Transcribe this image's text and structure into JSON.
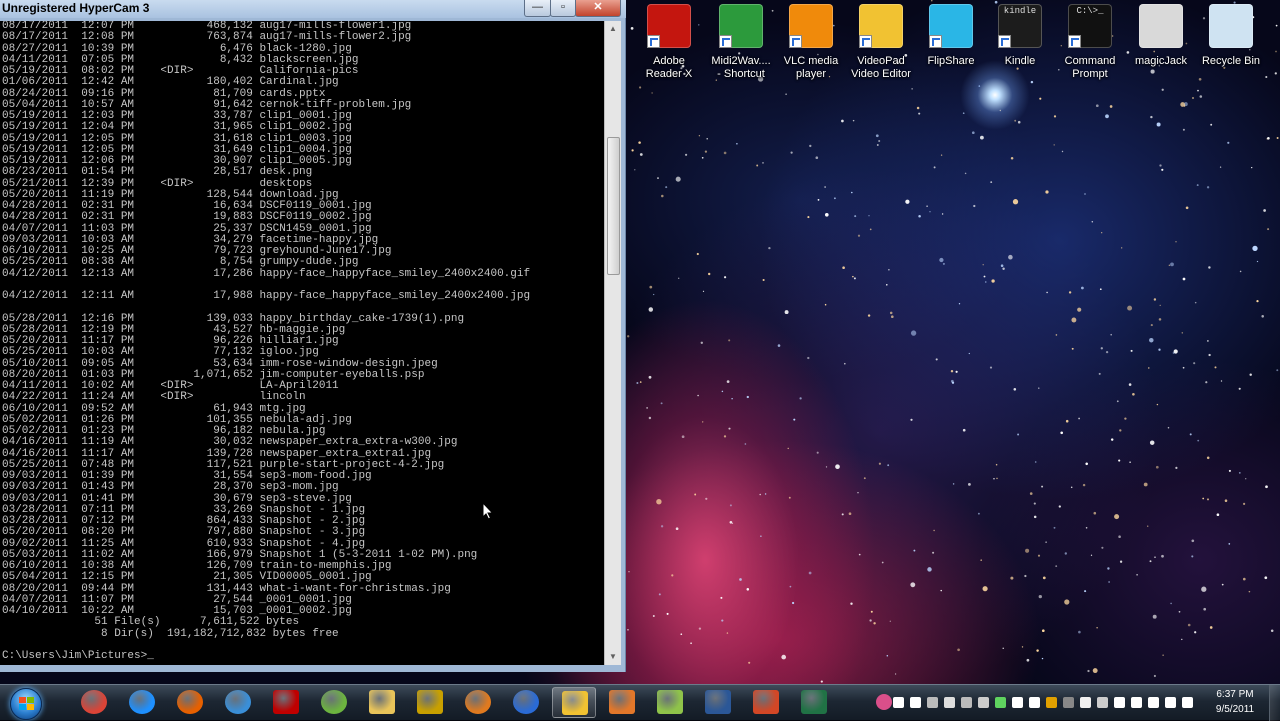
{
  "window": {
    "title": "Unregistered HyperCam 3",
    "buttons": {
      "minimize": "—",
      "maximize": "▫",
      "close": "✕"
    }
  },
  "console": {
    "lines": [
      "08/17/2011  12:07 PM           468,132 aug17-mills-flower1.jpg",
      "08/17/2011  12:08 PM           763,874 aug17-mills-flower2.jpg",
      "08/27/2011  10:39 PM             6,476 black-1280.jpg",
      "04/11/2011  07:05 PM             8,432 blackscreen.jpg",
      "05/19/2011  08:02 PM    <DIR>          California-pics",
      "01/06/2011  12:42 AM           180,402 Cardinal.jpg",
      "08/24/2011  09:16 PM            81,709 cards.pptx",
      "05/04/2011  10:57 AM            91,642 cernok-tiff-problem.jpg",
      "05/19/2011  12:03 PM            33,787 clip1_0001.jpg",
      "05/19/2011  12:04 PM            31,965 clip1_0002.jpg",
      "05/19/2011  12:05 PM            31,618 clip1_0003.jpg",
      "05/19/2011  12:05 PM            31,649 clip1_0004.jpg",
      "05/19/2011  12:06 PM            30,907 clip1_0005.jpg",
      "08/23/2011  01:54 PM            28,517 desk.png",
      "05/21/2011  12:39 PM    <DIR>          desktops",
      "05/20/2011  11:19 PM           128,544 download.jpg",
      "04/28/2011  02:31 PM            16,634 DSCF0119_0001.jpg",
      "04/28/2011  02:31 PM            19,883 DSCF0119_0002.jpg",
      "04/07/2011  11:03 PM            25,337 DSCN1459_0001.jpg",
      "09/03/2011  10:03 AM            34,279 facetime-happy.jpg",
      "06/10/2011  10:25 AM            79,723 greyhound-June17.jpg",
      "05/25/2011  08:38 AM             8,754 grumpy-dude.jpg",
      "04/12/2011  12:13 AM            17,286 happy-face_happyface_smiley_2400x2400.gif",
      "",
      "04/12/2011  12:11 AM            17,988 happy-face_happyface_smiley_2400x2400.jpg",
      "",
      "05/28/2011  12:16 PM           139,033 happy_birthday_cake-1739(1).png",
      "05/28/2011  12:19 PM            43,527 hb-maggie.jpg",
      "05/20/2011  11:17 PM            96,226 hilliar1.jpg",
      "05/25/2011  10:03 AM            77,132 igloo.jpg",
      "05/10/2011  09:05 AM            53,634 imm-rose-window-design.jpeg",
      "08/20/2011  01:03 PM         1,071,652 jim-computer-eyeballs.psp",
      "04/11/2011  10:02 AM    <DIR>          LA-April2011",
      "04/22/2011  11:24 AM    <DIR>          lincoln",
      "06/10/2011  09:52 AM            61,943 mtg.jpg",
      "05/02/2011  01:26 PM           101,355 nebula-adj.jpg",
      "05/02/2011  01:23 PM            96,182 nebula.jpg",
      "04/16/2011  11:19 AM            30,032 newspaper_extra_extra-w300.jpg",
      "04/16/2011  11:17 AM           139,728 newspaper_extra_extra1.jpg",
      "05/25/2011  07:48 PM           117,521 purple-start-project-4-2.jpg",
      "09/03/2011  01:39 PM            31,554 sep3-mom-food.jpg",
      "09/03/2011  01:43 PM            28,370 sep3-mom.jpg",
      "09/03/2011  01:41 PM            30,679 sep3-steve.jpg",
      "03/28/2011  07:11 PM            33,269 Snapshot - 1.jpg",
      "03/28/2011  07:12 PM           864,433 Snapshot - 2.jpg",
      "05/20/2011  08:20 PM           797,880 Snapshot - 3.jpg",
      "09/02/2011  11:25 AM           610,933 Snapshot - 4.jpg",
      "05/03/2011  11:02 AM           166,979 Snapshot 1 (5-3-2011 1-02 PM).png",
      "06/10/2011  10:38 AM           126,709 train-to-memphis.jpg",
      "05/04/2011  12:15 PM            21,305 VID00005_0001.jpg",
      "08/20/2011  09:44 PM           131,443 what-i-want-for-christmas.jpg",
      "04/07/2011  11:07 PM            27,544 _0001_0001.jpg",
      "04/10/2011  10:22 AM            15,703 _0001_0002.jpg",
      "              51 File(s)      7,611,522 bytes",
      "               8 Dir(s)  191,182,712,832 bytes free",
      "",
      "C:\\Users\\Jim\\Pictures>_"
    ]
  },
  "desktop_icons": [
    {
      "label_line1": "Adobe",
      "label_line2": "Reader X",
      "icon": "adobe-reader-icon",
      "color": "#c4160f"
    },
    {
      "label_line1": "Midi2Wav....",
      "label_line2": "- Shortcut",
      "icon": "midi2wav-icon",
      "color": "#2c9a3c"
    },
    {
      "label_line1": "VLC media",
      "label_line2": "player",
      "icon": "vlc-icon",
      "color": "#f08a0b"
    },
    {
      "label_line1": "VideoPad",
      "label_line2": "Video Editor",
      "icon": "videopad-icon",
      "color": "#f1c232"
    },
    {
      "label_line1": "FlipShare",
      "label_line2": "",
      "icon": "flipshare-icon",
      "color": "#2ab6e6"
    },
    {
      "label_line1": "Kindle",
      "label_line2": "",
      "icon": "kindle-icon",
      "color": "#1c1c1c",
      "badge": "kindle"
    },
    {
      "label_line1": "Command",
      "label_line2": "Prompt",
      "icon": "command-prompt-icon",
      "color": "#111111",
      "badge": "C:\\>_"
    },
    {
      "label_line1": "magicJack",
      "label_line2": "",
      "icon": "magicjack-icon",
      "color": "#d9d9d9"
    },
    {
      "label_line1": "Recycle Bin",
      "label_line2": "",
      "icon": "recycle-bin-icon",
      "color": "#cfe3f2"
    }
  ],
  "taskbar": {
    "items": [
      {
        "name": "chrome-icon",
        "color": "#db4437"
      },
      {
        "name": "internet-explorer-icon",
        "color": "#1e90ff"
      },
      {
        "name": "firefox-icon",
        "color": "#e66000"
      },
      {
        "name": "safari-icon",
        "color": "#3a8fd8"
      },
      {
        "name": "filezilla-icon",
        "color": "#bf0000"
      },
      {
        "name": "green-globe-icon",
        "color": "#6cb43f"
      },
      {
        "name": "file-explorer-icon",
        "color": "#e8c45a"
      },
      {
        "name": "ultraedit-icon",
        "color": "#c8a000"
      },
      {
        "name": "fox-app-icon",
        "color": "#e07a1f"
      },
      {
        "name": "headset-app-icon",
        "color": "#2a6bd6"
      },
      {
        "name": "videopad-taskbar-icon",
        "color": "#f1c232"
      },
      {
        "name": "paint-icon",
        "color": "#e2772a"
      },
      {
        "name": "notepad-icon",
        "color": "#8fc34a"
      },
      {
        "name": "word-icon",
        "color": "#2b5797"
      },
      {
        "name": "powerpoint-icon",
        "color": "#d24726"
      },
      {
        "name": "excel-icon",
        "color": "#207245"
      }
    ],
    "active_index": 10,
    "clock": {
      "time": "6:37 PM",
      "date": "9/5/2011"
    }
  }
}
